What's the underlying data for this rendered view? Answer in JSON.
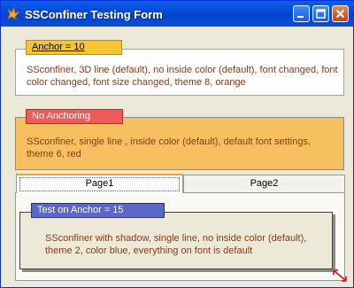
{
  "window": {
    "title": "SSConfiner Testing Form"
  },
  "confiner1": {
    "label": "Anchor = 10",
    "text": "SSconfiner, 3D line (default), no inside color (default), font changed, font color changed, font size changed, theme 8, orange"
  },
  "confiner2": {
    "label": "No Anchoring",
    "text": "SSconfiner,  single line , inside color (default),  default font settings, theme 6, red"
  },
  "tabs": [
    {
      "label": "Page1"
    },
    {
      "label": "Page2"
    }
  ],
  "confiner3": {
    "label": "Test on Anchor = 15",
    "text": "SSconfiner with shadow, single line, no inside color (default), theme 2, color blue, everything on font is default"
  },
  "colors": {
    "orange": "#f6c060",
    "red": "#ef5a5a",
    "blue": "#5a66c8",
    "title_bar": "#0348d8"
  }
}
